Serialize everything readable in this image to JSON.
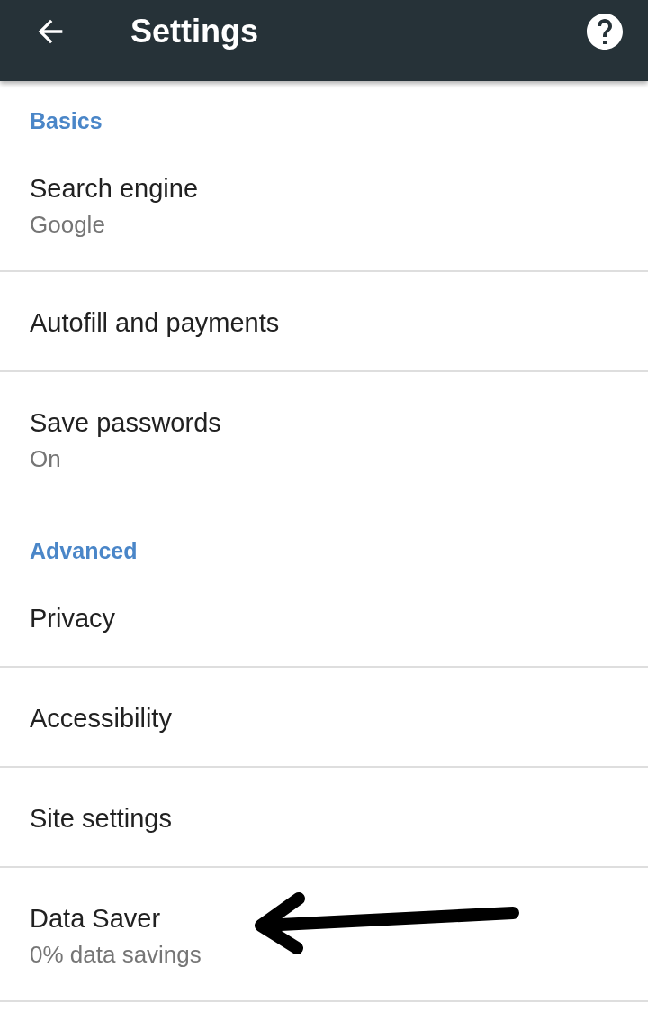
{
  "toolbar": {
    "title": "Settings"
  },
  "sections": [
    {
      "header": "Basics",
      "items": [
        {
          "title": "Search engine",
          "subtitle": "Google",
          "annotated": false
        },
        {
          "title": "Autofill and payments",
          "annotated": false
        },
        {
          "title": "Save passwords",
          "subtitle": "On",
          "annotated": false
        }
      ]
    },
    {
      "header": "Advanced",
      "items": [
        {
          "title": "Privacy",
          "annotated": false
        },
        {
          "title": "Accessibility",
          "annotated": false
        },
        {
          "title": "Site settings",
          "annotated": false
        },
        {
          "title": "Data Saver",
          "subtitle": "0% data savings",
          "annotated": true
        }
      ]
    }
  ]
}
